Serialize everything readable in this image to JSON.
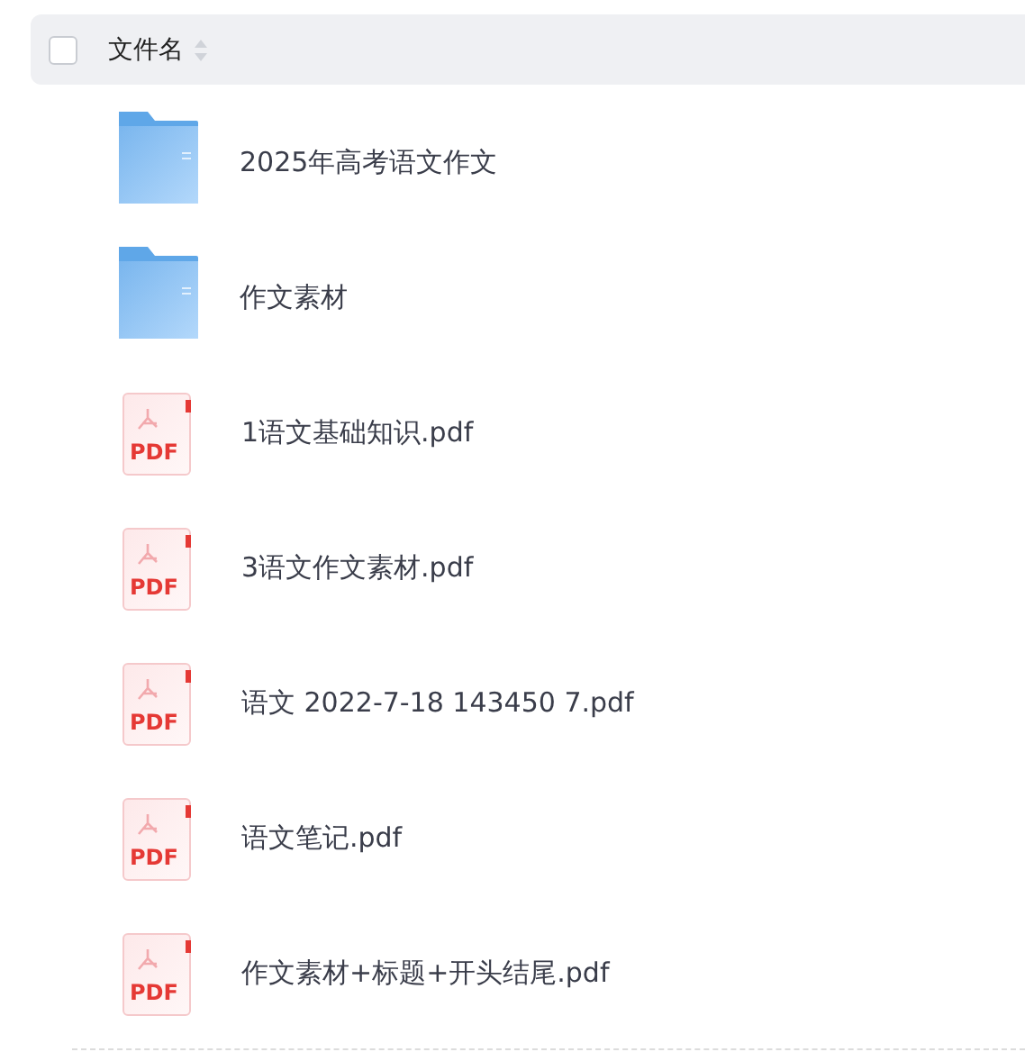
{
  "header": {
    "checked": false,
    "column_label": "文件名"
  },
  "files": [
    {
      "kind": "folder",
      "name": "2025年高考语文作文"
    },
    {
      "kind": "folder",
      "name": "作文素材"
    },
    {
      "kind": "pdf",
      "icon_label": "PDF",
      "name": "1语文基础知识.pdf"
    },
    {
      "kind": "pdf",
      "icon_label": "PDF",
      "name": "3语文作文素材.pdf"
    },
    {
      "kind": "pdf",
      "icon_label": "PDF",
      "name": "语文 2022-7-18 143450 7.pdf"
    },
    {
      "kind": "pdf",
      "icon_label": "PDF",
      "name": "语文笔记.pdf"
    },
    {
      "kind": "pdf",
      "icon_label": "PDF",
      "name": "作文素材+标题+开头结尾.pdf"
    }
  ]
}
